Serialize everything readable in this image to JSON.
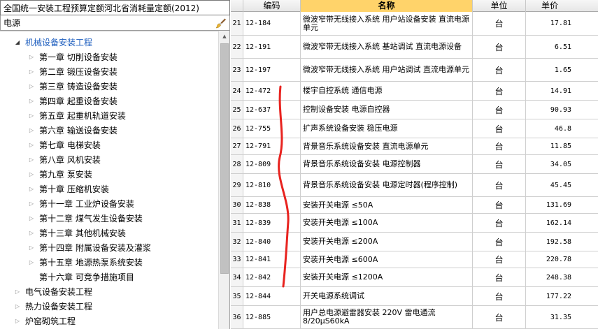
{
  "quota_select": {
    "value": "全国统一安装工程预算定额河北省消耗量定额(2012)"
  },
  "search": {
    "value": "电源",
    "icon": "brush-icon"
  },
  "tree": [
    {
      "label": "机械设备安装工程",
      "level": 0,
      "state": "open",
      "selected": true
    },
    {
      "label": "第一章  切削设备安装",
      "level": 1,
      "state": "closed"
    },
    {
      "label": "第二章  锻压设备安装",
      "level": 1,
      "state": "closed"
    },
    {
      "label": "第三章  铸造设备安装",
      "level": 1,
      "state": "closed"
    },
    {
      "label": "第四章  起重设备安装",
      "level": 1,
      "state": "closed"
    },
    {
      "label": "第五章  起重机轨道安装",
      "level": 1,
      "state": "closed"
    },
    {
      "label": "第六章  输送设备安装",
      "level": 1,
      "state": "closed"
    },
    {
      "label": "第七章  电梯安装",
      "level": 1,
      "state": "closed"
    },
    {
      "label": "第八章  风机安装",
      "level": 1,
      "state": "closed"
    },
    {
      "label": "第九章  泵安装",
      "level": 1,
      "state": "closed"
    },
    {
      "label": "第十章  压缩机安装",
      "level": 1,
      "state": "closed"
    },
    {
      "label": "第十一章  工业炉设备安装",
      "level": 1,
      "state": "closed"
    },
    {
      "label": "第十二章  煤气发生设备安装",
      "level": 1,
      "state": "closed"
    },
    {
      "label": "第十三章  其他机械安装",
      "level": 1,
      "state": "closed"
    },
    {
      "label": "第十四章  附属设备安装及灌浆",
      "level": 1,
      "state": "closed"
    },
    {
      "label": "第十五章  地源热泵系统安装",
      "level": 1,
      "state": "closed"
    },
    {
      "label": "第十六章  可竞争措施项目",
      "level": 1,
      "state": "none"
    },
    {
      "label": "电气设备安装工程",
      "level": 0,
      "state": "closed"
    },
    {
      "label": "热力设备安装工程",
      "level": 0,
      "state": "closed"
    },
    {
      "label": "炉窑砌筑工程",
      "level": 0,
      "state": "closed"
    }
  ],
  "grid": {
    "columns": [
      "",
      "编码",
      "名称",
      "单位",
      "单价"
    ],
    "rows": [
      {
        "idx": "21",
        "code": "12-184",
        "name": "微波窄带无线接入系统  用户站设备安装  直流电源单元",
        "unit": "台",
        "price": "17.81"
      },
      {
        "idx": "22",
        "code": "12-191",
        "name": "微波窄带无线接入系统  基站调试  直流电源设备",
        "unit": "台",
        "price": "6.51"
      },
      {
        "idx": "23",
        "code": "12-197",
        "name": "微波窄带无线接入系统  用户站调试  直流电源单元",
        "unit": "台",
        "price": "1.65"
      },
      {
        "idx": "24",
        "code": "12-472",
        "name": "楼宇自控系统  通信电源",
        "unit": "台",
        "price": "14.91"
      },
      {
        "idx": "25",
        "code": "12-637",
        "name": "控制设备安装  电源自控器",
        "unit": "台",
        "price": "90.93"
      },
      {
        "idx": "26",
        "code": "12-755",
        "name": "扩声系统设备安装  稳压电源",
        "unit": "台",
        "price": "46.8"
      },
      {
        "idx": "27",
        "code": "12-791",
        "name": "背景音乐系统设备安装  直流电源单元",
        "unit": "台",
        "price": "11.85"
      },
      {
        "idx": "28",
        "code": "12-809",
        "name": "背景音乐系统设备安装  电源控制器",
        "unit": "台",
        "price": "34.05"
      },
      {
        "idx": "29",
        "code": "12-810",
        "name": "背景音乐系统设备安装  电源定时器(程序控制)",
        "unit": "台",
        "price": "45.45"
      },
      {
        "idx": "30",
        "code": "12-838",
        "name": "安装开关电源  ≤50A",
        "unit": "台",
        "price": "131.69"
      },
      {
        "idx": "31",
        "code": "12-839",
        "name": "安装开关电源  ≤100A",
        "unit": "台",
        "price": "162.14"
      },
      {
        "idx": "32",
        "code": "12-840",
        "name": "安装开关电源  ≤200A",
        "unit": "台",
        "price": "192.58"
      },
      {
        "idx": "33",
        "code": "12-841",
        "name": "安装开关电源  ≤600A",
        "unit": "台",
        "price": "220.78"
      },
      {
        "idx": "34",
        "code": "12-842",
        "name": "安装开关电源  ≤1200A",
        "unit": "台",
        "price": "248.38"
      },
      {
        "idx": "35",
        "code": "12-844",
        "name": "开关电源系统调试",
        "unit": "台",
        "price": "177.22"
      },
      {
        "idx": "36",
        "code": "12-885",
        "name": "用户总电源避雷器安装  220V  雷电通流8/20μS60kA",
        "unit": "台",
        "price": "31.35"
      }
    ]
  },
  "colors": {
    "selected_text": "#1f5fbf",
    "header_active": "#ffd36a",
    "annotation": "#e8231f"
  }
}
